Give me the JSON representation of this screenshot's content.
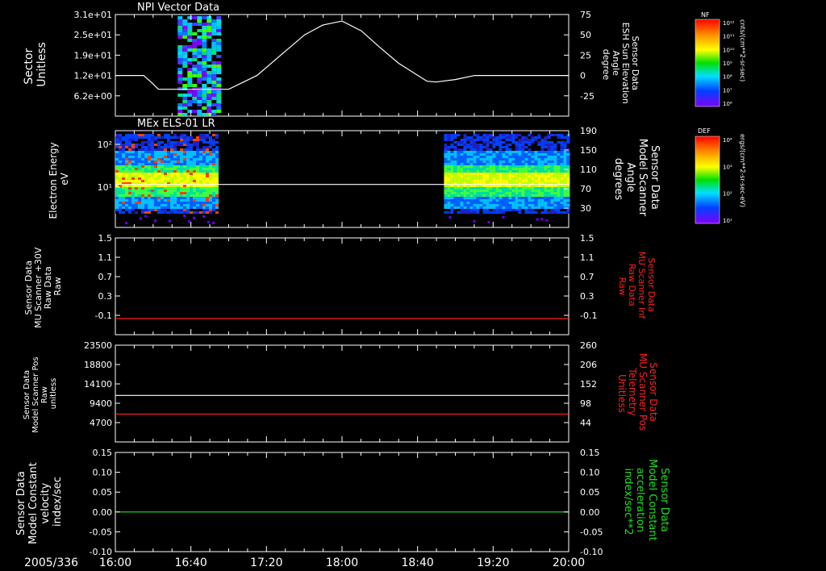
{
  "colors": {
    "background": "#000000",
    "axis": "#ffffff",
    "trace_white": "#ffffff",
    "trace_red": "#ff2020",
    "trace_green": "#20e020",
    "label_red": "#ff2020",
    "label_green": "#20e020"
  },
  "time_axis": {
    "date_label": "2005/336",
    "ticks": [
      "16:00",
      "16:40",
      "17:20",
      "18:00",
      "18:40",
      "19:20",
      "20:00"
    ],
    "range": [
      "16:00",
      "20:00"
    ]
  },
  "panels": [
    {
      "title": "NPI Vector Data",
      "left_label": [
        "Sector",
        "Unitless"
      ],
      "left_ticks": [
        "3.1e+01",
        "2.5e+01",
        "1.9e+01",
        "1.2e+01",
        "6.2e+00"
      ],
      "right_label": [
        "Sensor Data",
        "ESH Sun Elevation",
        "Angle",
        "degree"
      ],
      "right_ticks": [
        "75",
        "50",
        "25",
        "0",
        "-25"
      ],
      "colorbar": {
        "label": "NF",
        "units": "cnts/(cm**2-sr-sec)",
        "ticks": [
          "10¹²",
          "10¹¹",
          "10¹⁰",
          "10⁹",
          "10⁸",
          "10⁷",
          "10⁶"
        ]
      }
    },
    {
      "title": "MEx ELS-01 LR",
      "left_label": [
        "Electron Energy",
        "eV"
      ],
      "left_ticks": [
        "10²",
        "10¹"
      ],
      "right_label": [
        "Sensor Data",
        "Model Scanner",
        "Angle",
        "degrees"
      ],
      "right_ticks": [
        "190",
        "150",
        "110",
        "70",
        "30"
      ],
      "colorbar": {
        "label": "DEF",
        "units": "ergs/(cm**2-sr-sec-eV)",
        "ticks": [
          "10⁴",
          "10³",
          "10²",
          "10¹"
        ]
      }
    },
    {
      "left_label": [
        "Sensor Data",
        "MU Scanner +30V",
        "Raw Data",
        "Raw"
      ],
      "left_ticks": [
        "1.5",
        "1.1",
        "0.7",
        "0.3",
        "-0.1"
      ],
      "right_label": [
        "Sensor Data",
        "MU Scanner Inf",
        "Raw Data",
        "Raw"
      ],
      "right_ticks": [
        "1.5",
        "1.1",
        "0.7",
        "0.3",
        "-0.1"
      ]
    },
    {
      "left_label": [
        "Sensor Data",
        "Model Scanner Pos",
        "Raw",
        "unitless"
      ],
      "left_ticks": [
        "23500",
        "18800",
        "14100",
        "9400",
        "4700"
      ],
      "right_label": [
        "Sensor Data",
        "MU Scanner Pos",
        "Telemetry",
        "Unitless"
      ],
      "right_ticks": [
        "260",
        "206",
        "152",
        "98",
        "44"
      ]
    },
    {
      "left_label": [
        "Sensor Data",
        "Model Constant",
        "velocity",
        "index/sec"
      ],
      "left_ticks": [
        "0.15",
        "0.10",
        "0.05",
        "0.00",
        "-0.05",
        "-0.10"
      ],
      "right_label": [
        "Sensor Data",
        "Model Constant",
        "acceleration",
        "index/sec**2"
      ],
      "right_ticks": [
        "0.15",
        "0.10",
        "0.05",
        "0.00",
        "-0.05",
        "-0.10"
      ]
    }
  ],
  "chart_data": [
    {
      "type": "line",
      "title": "NPI Vector Data",
      "xlabel": "",
      "ylabel": "Sector Unitless",
      "y2label": "Sensor Data ESH Sun Elevation Angle degree",
      "xlim": [
        "16:00",
        "20:00"
      ],
      "ylim2": [
        -50,
        75
      ],
      "series": [
        {
          "name": "ESH Sun Elevation Angle",
          "axis": "right",
          "x": [
            0,
            0.25,
            0.33,
            0.38,
            0.75,
            0.88,
            1.0,
            1.25,
            1.5,
            1.67,
            1.83,
            2.0,
            2.17,
            2.33,
            2.5,
            2.67,
            2.75,
            2.83,
            3.0,
            3.17,
            3.33,
            3.5,
            3.75,
            4.0
          ],
          "values": [
            0,
            0,
            -10,
            -17,
            -17,
            -17,
            -17,
            0,
            30,
            50,
            62,
            67,
            55,
            35,
            15,
            0,
            -7,
            -8,
            -5,
            0,
            0,
            0,
            0,
            0
          ]
        }
      ],
      "spectrogram_blocks": [
        {
          "x_start": 0.55,
          "x_end": 0.9,
          "sector_ranges": [
            [
              6,
              31
            ]
          ]
        }
      ]
    },
    {
      "type": "heatmap",
      "title": "MEx ELS-01 LR",
      "ylabel": "Electron Energy eV",
      "y2label": "Sensor Data Model Scanner Angle degrees",
      "ylim_log": [
        3,
        200
      ],
      "ylim2": [
        10,
        190
      ],
      "data_intervals": [
        [
          0,
          0.9
        ],
        [
          2.9,
          4.0
        ]
      ],
      "series": [
        {
          "name": "Model Scanner Angle",
          "axis": "right",
          "x": [
            0,
            4.0
          ],
          "values": [
            90,
            90
          ]
        }
      ]
    },
    {
      "type": "line",
      "ylabel": "Sensor Data MU Scanner +30V Raw Data Raw",
      "y2label": "Sensor Data MU Scanner Inf Raw Data Raw",
      "ylim": [
        -0.3,
        1.5
      ],
      "series": [
        {
          "name": "MU Scanner Inf",
          "axis": "right",
          "x": [
            0,
            4.0
          ],
          "values": [
            0.0,
            0.0
          ]
        }
      ]
    },
    {
      "type": "line",
      "ylabel": "Sensor Data Model Scanner Pos Raw unitless",
      "y2label": "Sensor Data MU Scanner Pos Telemetry Unitless",
      "ylim": [
        0,
        23500
      ],
      "ylim2": [
        17,
        260
      ],
      "series": [
        {
          "name": "Model Scanner Pos",
          "axis": "left",
          "x": [
            0,
            4.0
          ],
          "values": [
            11300,
            11300
          ]
        },
        {
          "name": "MU Scanner Pos",
          "axis": "right",
          "x": [
            0,
            4.0
          ],
          "values": [
            87,
            87
          ]
        }
      ]
    },
    {
      "type": "line",
      "ylabel": "Sensor Data Model Constant velocity index/sec",
      "y2label": "Sensor Data Model Constant acceleration index/sec**2",
      "ylim": [
        -0.1,
        0.15
      ],
      "series": [
        {
          "name": "Model Constant acceleration",
          "axis": "right",
          "x": [
            0,
            4.0
          ],
          "values": [
            0.0,
            0.0
          ]
        }
      ]
    }
  ]
}
